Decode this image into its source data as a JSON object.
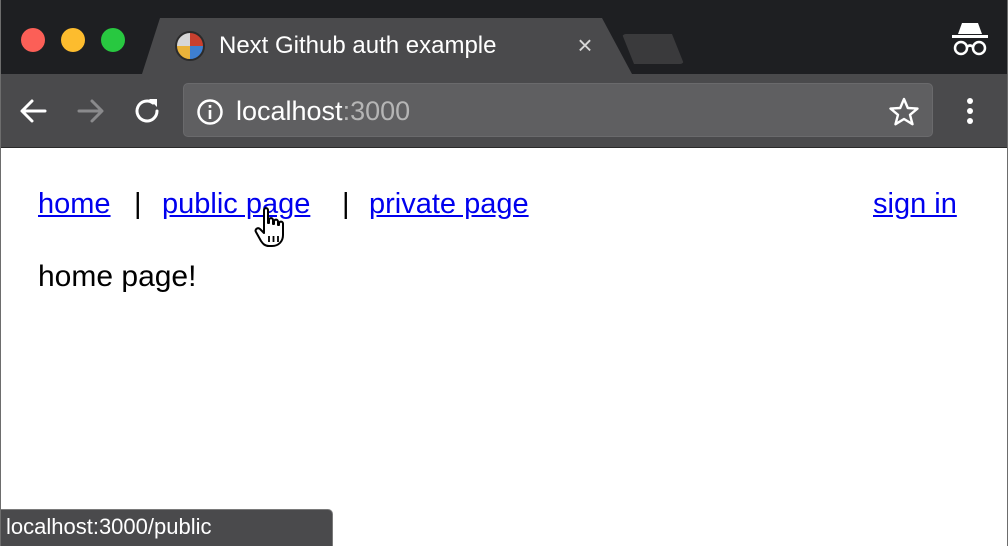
{
  "browser": {
    "tab_title": "Next Github auth example",
    "url_host": "localhost",
    "url_port": ":3000",
    "status_url": "localhost:3000/public"
  },
  "nav": {
    "links": [
      {
        "label": "home"
      },
      {
        "label": "public page"
      },
      {
        "label": "private page"
      }
    ],
    "separator": "|",
    "sign_in": "sign in"
  },
  "main": {
    "text": "home page!"
  },
  "colors": {
    "link": "#0000ee",
    "chrome_dark": "#1e1f22",
    "chrome_toolbar": "#4a4a4c",
    "traffic_close": "#fc5f57",
    "traffic_min": "#fdbc2e",
    "traffic_max": "#28c840"
  },
  "icons": {
    "back": "arrow-left-icon",
    "forward": "arrow-right-icon",
    "reload": "reload-icon",
    "info": "info-icon",
    "star": "star-icon",
    "menu": "kebab-menu-icon",
    "incognito": "incognito-icon",
    "cursor": "hand-pointer-icon"
  }
}
